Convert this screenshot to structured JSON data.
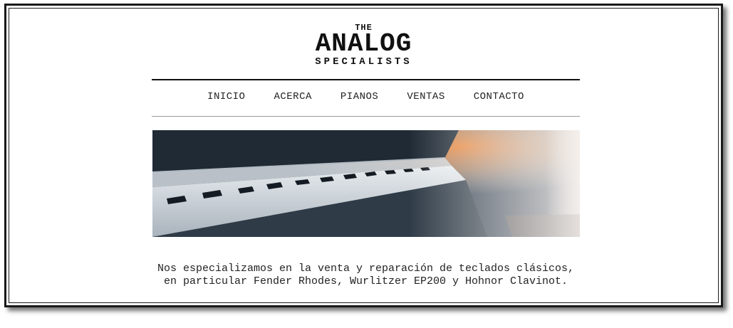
{
  "logo": {
    "the": "THE",
    "main": "ANALOG",
    "sub": "SPECIALISTS"
  },
  "nav": {
    "items": [
      {
        "label": "INICIO"
      },
      {
        "label": "ACERCA"
      },
      {
        "label": "PIANOS"
      },
      {
        "label": "VENTAS"
      },
      {
        "label": "CONTACTO"
      }
    ]
  },
  "hero": {
    "alt": "Piano keys"
  },
  "caption": {
    "text": "Nos especializamos en la venta y reparación de teclados clásicos, en particular Fender Rhodes, Wurlitzer EP200 y Hohnor Clavinot."
  },
  "colors": {
    "text": "#222222",
    "accent_glow": "#f08a3c",
    "frame": "#1a1a1a"
  }
}
